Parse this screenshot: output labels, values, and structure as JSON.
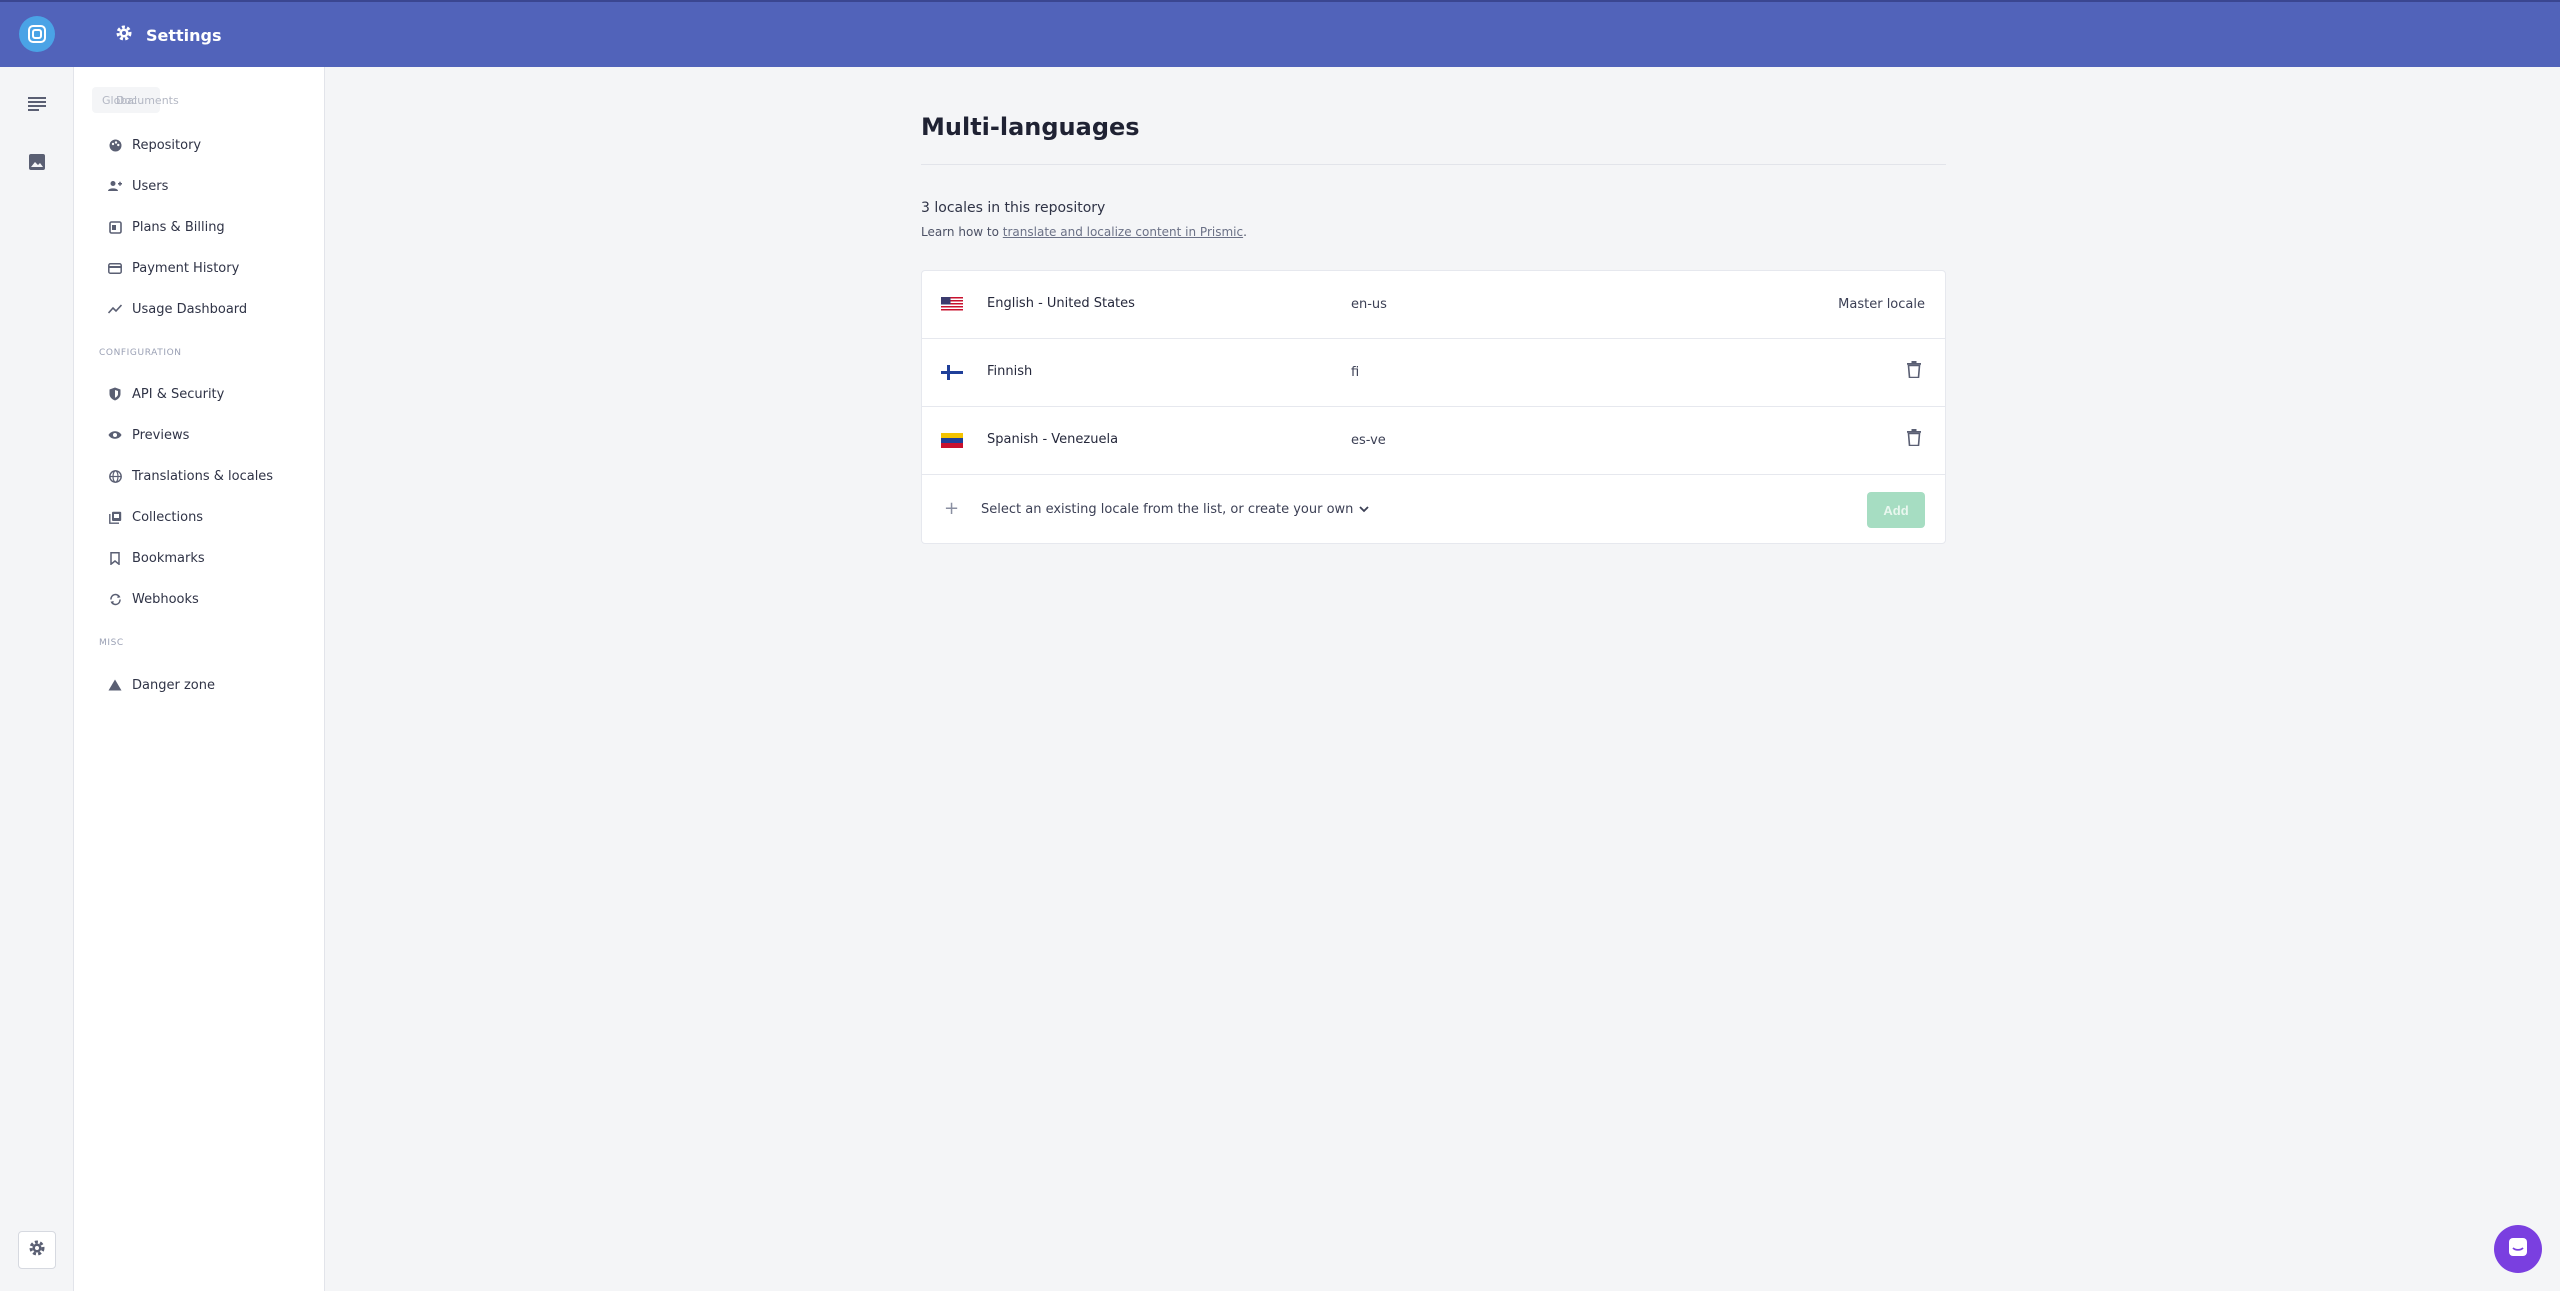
{
  "topbar": {
    "title": "Settings"
  },
  "sidebar": {
    "overlap_a": "Documents",
    "overlap_b": "Global",
    "items": [
      {
        "label": "Repository",
        "icon": "palette-icon"
      },
      {
        "label": "Users",
        "icon": "users-icon"
      },
      {
        "label": "Plans & Billing",
        "icon": "billing-icon"
      },
      {
        "label": "Payment History",
        "icon": "card-icon"
      },
      {
        "label": "Usage Dashboard",
        "icon": "chart-line-icon"
      }
    ],
    "section_config": "CONFIGURATION",
    "config_items": [
      {
        "label": "API & Security",
        "icon": "shield-icon"
      },
      {
        "label": "Previews",
        "icon": "eye-icon"
      },
      {
        "label": "Translations & locales",
        "icon": "globe-icon"
      },
      {
        "label": "Collections",
        "icon": "collections-icon"
      },
      {
        "label": "Bookmarks",
        "icon": "bookmark-icon"
      },
      {
        "label": "Webhooks",
        "icon": "sync-icon"
      }
    ],
    "section_misc": "MISC",
    "misc_items": [
      {
        "label": "Danger zone",
        "icon": "warning-icon"
      }
    ]
  },
  "main": {
    "title": "Multi-languages",
    "count": "3 locales in this repository",
    "learn_prefix": "Learn how to ",
    "learn_link": "translate and localize content in Prismic",
    "learn_suffix": ".",
    "locales": [
      {
        "name": "English - United States",
        "code": "en-us",
        "right": "Master locale",
        "flag": "us-flag-icon"
      },
      {
        "name": "Finnish",
        "code": "fi",
        "flag": "finland-flag-icon"
      },
      {
        "name": "Spanish - Venezuela",
        "code": "es-ve",
        "flag": "venezuela-flag-icon"
      }
    ],
    "select_placeholder": "Select an existing locale from the list, or create your own",
    "add_label": "Add"
  },
  "colors": {
    "topbar": "#5163ba",
    "add_button": "#a6ddc2",
    "chat": "#7a3fe0"
  }
}
